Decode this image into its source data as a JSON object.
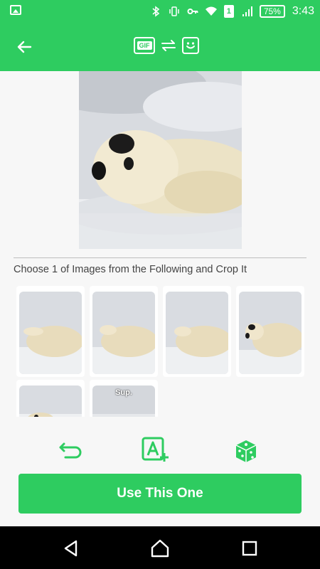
{
  "status_bar": {
    "battery": "75%",
    "time": "3:43",
    "sim_slot": "1",
    "icons": [
      "image-icon",
      "bluetooth-icon",
      "vibrate-icon",
      "key-icon",
      "wifi-icon",
      "signal-icon"
    ]
  },
  "app_bar": {
    "back_icon": "arrow-left-icon",
    "gif_label": "GIF",
    "swap_icon": "swap-arrows-icon",
    "sticker_icon": "sticker-smile-icon"
  },
  "main": {
    "instruction": "Choose 1 of Images from the Following and Crop It",
    "frames": [
      {
        "label": ""
      },
      {
        "label": ""
      },
      {
        "label": ""
      },
      {
        "label": ""
      },
      {
        "label": ""
      },
      {
        "label": "Sup."
      }
    ]
  },
  "tools": {
    "undo_icon": "undo-icon",
    "add_text_icon": "add-text-icon",
    "random_icon": "dice-icon"
  },
  "primary_action": {
    "label": "Use This One"
  },
  "nav_bar": {
    "back_icon": "nav-back-icon",
    "home_icon": "nav-home-icon",
    "recents_icon": "nav-recents-icon"
  },
  "colors": {
    "accent": "#2ecc60",
    "background": "#f7f7f7"
  }
}
